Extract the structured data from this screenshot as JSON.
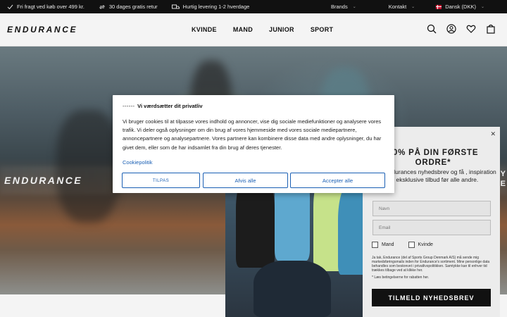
{
  "topbar": {
    "usps": [
      {
        "icon": "check-icon",
        "text": "Fri fragt ved køb over 499 kr."
      },
      {
        "icon": "return-icon",
        "text": "30 dages gratis retur"
      },
      {
        "icon": "truck-icon",
        "text": "Hurtig levering 1-2 hverdage"
      }
    ],
    "brands_label": "Brands",
    "contact_label": "Kontakt",
    "country_label": "Dansk (DKK)"
  },
  "header": {
    "logo": "ENDURANCE",
    "nav": [
      "KVINDE",
      "MAND",
      "JUNIOR",
      "SPORT"
    ]
  },
  "hero": {
    "logo": "ENDURANCE",
    "partial_text": "Y\nE"
  },
  "cookie": {
    "title": "Vi værdsætter dit privatliv",
    "body": "Vi bruger cookies til at tilpasse vores indhold og annoncer, vise dig sociale mediefunktioner og analysere vores trafik. Vi deler også oplysninger om din brug af vores hjemmeside med vores sociale mediepartnere, annoncepartnere og analysepartnere. Vores partnere kan kombinere disse data med andre oplysninger, du har givet dem, eller som de har indsamlet fra din brug af deres tjenester.",
    "policy_link": "Cookiepolitik",
    "btn_customize": "TILPAS",
    "btn_reject": "Afvis alle",
    "btn_accept": "Accepter alle"
  },
  "newsletter": {
    "title": "20% PÅ DIN FØRSTE ORDRE*",
    "text": "d dig Endurances nyhedsbrev og få , inspiration og eksklusive tilbud før alle andre.",
    "name_placeholder": "Navn",
    "email_placeholder": "Email",
    "option_male": "Mand",
    "option_female": "Kvinde",
    "legal": "Ja tak, Endurance (del af Sports Group Denmark A/S) må sende mig markedsføringsmails inden for Endurance's sortiment. Mine personlige data behandles som beskrevet i privatlivspolitikken. Samtykke kan til enhver tid trækkes tilbage ved at klikke her.",
    "note": "* Læs betingelserne for rabatten her.",
    "submit": "TILMELD NYHEDSBREV",
    "close": "✕"
  },
  "colors": {
    "topbar_bg": "#111111",
    "link_blue": "#1a5fb4",
    "button_black": "#111111"
  }
}
